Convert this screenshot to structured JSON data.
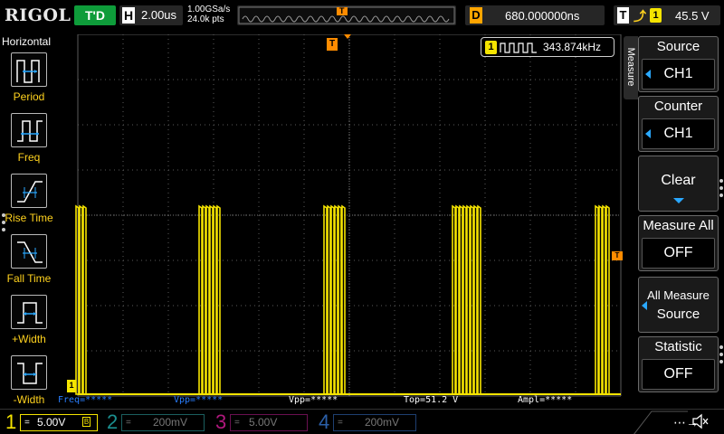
{
  "brand": "RIGOL",
  "run_state": "T'D",
  "horizontal": {
    "key": "H",
    "timebase": "2.00us"
  },
  "sampling": {
    "rate": "1.00GSa/s",
    "depth": "24.0k pts"
  },
  "memory_marker": "T",
  "delay": {
    "key": "D",
    "value": "680.000000ns"
  },
  "trigger": {
    "key": "T",
    "slope_icon": "rising-edge-icon",
    "source": "1",
    "level": "45.5 V"
  },
  "left_panel": {
    "title": "Horizontal",
    "items": [
      {
        "label": "Period",
        "icon": "period-icon"
      },
      {
        "label": "Freq",
        "icon": "freq-icon"
      },
      {
        "label": "Rise Time",
        "icon": "rise-time-icon"
      },
      {
        "label": "Fall Time",
        "icon": "fall-time-icon"
      },
      {
        "label": "+Width",
        "icon": "positive-width-icon"
      },
      {
        "label": "-Width",
        "icon": "negative-width-icon"
      }
    ]
  },
  "freq_counter": {
    "channel": "1",
    "value": "343.874kHz"
  },
  "markers": {
    "trigger_pos": "T",
    "ch1_ground": "1"
  },
  "measurements": [
    {
      "text": "Freq=*****",
      "color": "#2a7fff"
    },
    {
      "text": "Vpp=*****",
      "color": "#2a7fff"
    },
    {
      "text": "Vpp=*****",
      "color": "#ffffff"
    },
    {
      "text": "Top=51.2 V",
      "color": "#ffffff"
    },
    {
      "text": "Ampl=*****",
      "color": "#ffffff"
    }
  ],
  "right_menu": {
    "tab": "Measure",
    "source": {
      "title": "Source",
      "value": "CH1"
    },
    "counter": {
      "title": "Counter",
      "value": "CH1"
    },
    "clear": {
      "title": "Clear"
    },
    "measure_all": {
      "title": "Measure All",
      "value": "OFF"
    },
    "all_measure_source": {
      "line1": "All Measure",
      "line2": "Source"
    },
    "statistic": {
      "title": "Statistic",
      "value": "OFF"
    }
  },
  "channels": [
    {
      "num": "1",
      "coupling": "=",
      "scale": "5.00V",
      "color": "#f5e400",
      "active": true
    },
    {
      "num": "2",
      "coupling": "=",
      "scale": "200mV",
      "color": "#1b8f8f",
      "active": false
    },
    {
      "num": "3",
      "coupling": "=",
      "scale": "5.00V",
      "color": "#b0187d",
      "active": false
    },
    {
      "num": "4",
      "coupling": "=",
      "scale": "200mV",
      "color": "#2b5fa8",
      "active": false
    }
  ],
  "status_icons": [
    "usb-icon",
    "speaker-muted-icon"
  ],
  "colors": {
    "ch1": "#f5e400",
    "accent": "#2aa8ff",
    "trigger_marker": "#ff8c00",
    "grid": "#5a5a5a"
  }
}
